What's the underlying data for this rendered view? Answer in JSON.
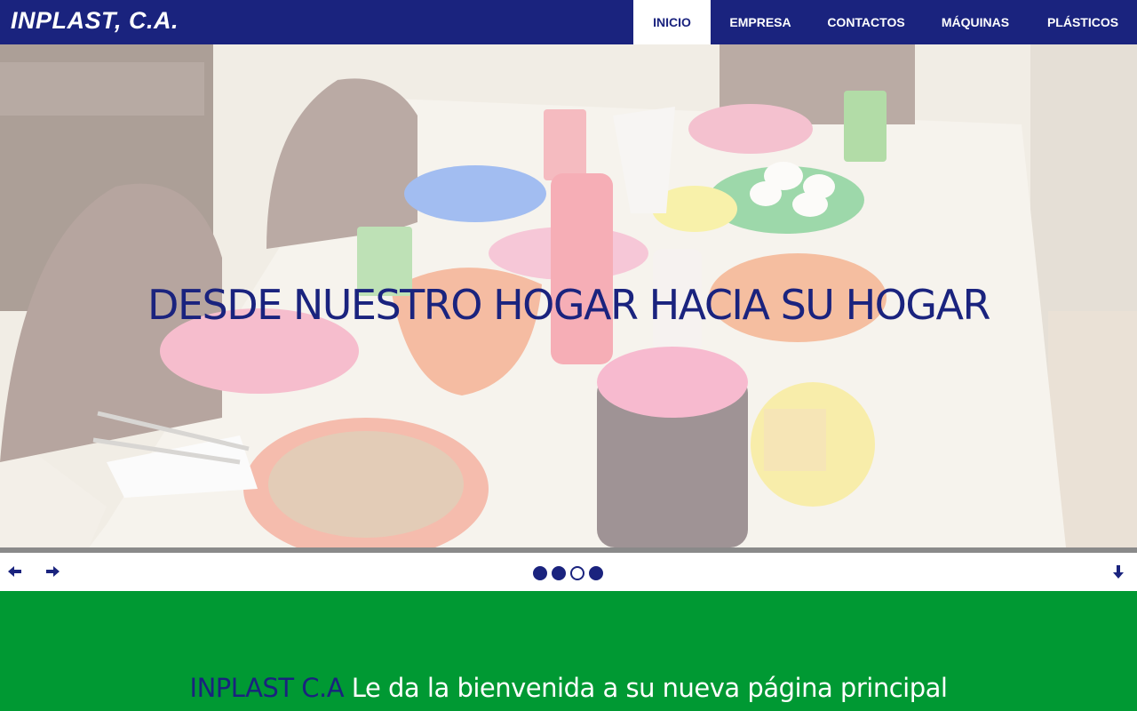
{
  "header": {
    "logo": "INPLAST, C.A.",
    "nav": [
      {
        "label": "INICIO",
        "active": true
      },
      {
        "label": "EMPRESA",
        "active": false
      },
      {
        "label": "CONTACTOS",
        "active": false
      },
      {
        "label": "MÁQUINAS",
        "active": false
      },
      {
        "label": "PLÁSTICOS",
        "active": false
      }
    ]
  },
  "hero": {
    "headline": "DESDE NUESTRO HOGAR HACIA SU HOGAR",
    "image_icon": "photo-dining-table-plastics"
  },
  "slider": {
    "prev_icon": "arrow-left-icon",
    "next_icon": "arrow-right-icon",
    "down_icon": "arrow-down-icon",
    "slide_count": 4,
    "active_slide": 3
  },
  "welcome": {
    "brand": "INPLAST C.A",
    "message": "Le da la bienvenida a su nueva página principal"
  },
  "colors": {
    "primary": "#1a237e",
    "accent": "#009933",
    "white": "#ffffff"
  }
}
